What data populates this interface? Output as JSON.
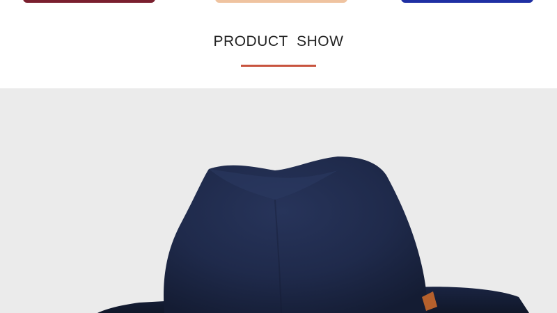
{
  "color_swatches": [
    {
      "color": "#7a1f2e"
    },
    {
      "color": "#efc3a0"
    },
    {
      "color": "#1f2fa3"
    }
  ],
  "section": {
    "title": "PRODUCT  SHOW",
    "underline_color": "#c8543e"
  },
  "product_photo": {
    "subject": "navy-felt-fedora-hat",
    "hat_color": "#1e2a4a",
    "band_color": "#b5602c",
    "background_color": "#ebebeb"
  }
}
